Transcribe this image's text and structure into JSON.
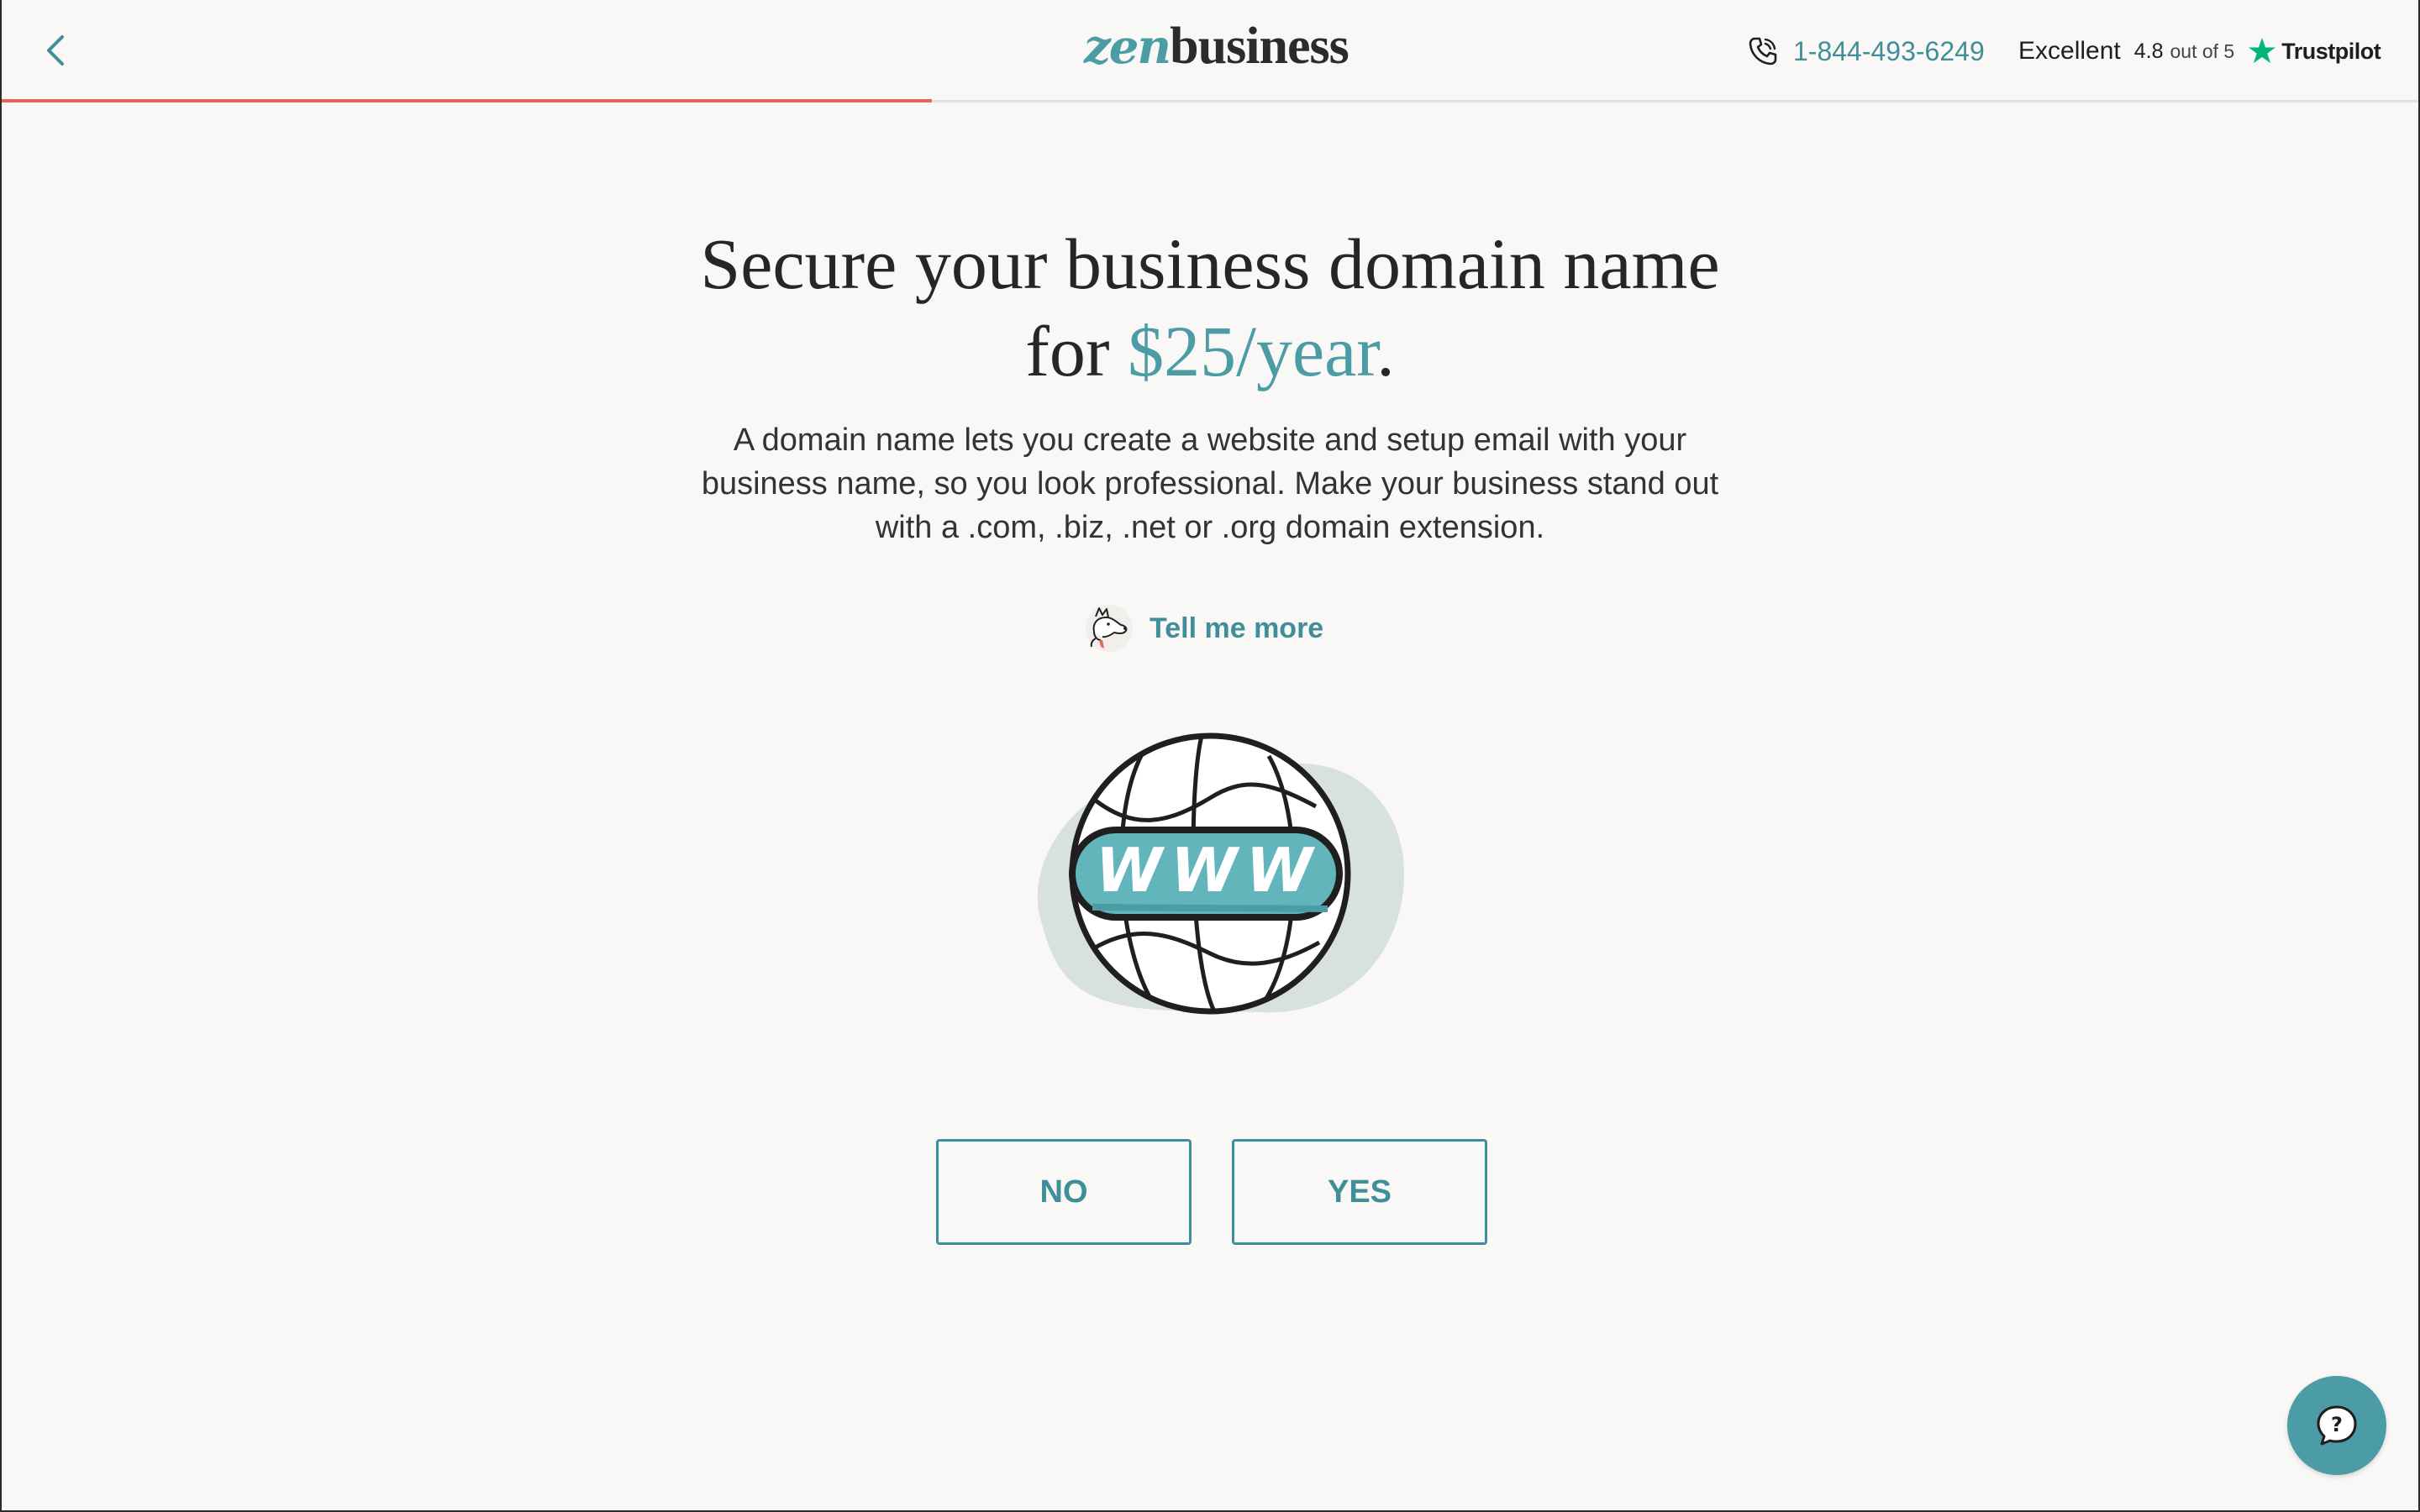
{
  "header": {
    "back_icon": "chevron-left-icon",
    "logo": {
      "zen": "zen",
      "business": "business"
    },
    "phone": {
      "icon": "phone-icon",
      "number": "1-844-493-6249"
    },
    "trustpilot": {
      "label": "Excellent",
      "rating": "4.8",
      "out_of": "out of 5",
      "brand": "Trustpilot",
      "star_color": "#00b67a"
    },
    "progress": 0.385
  },
  "main": {
    "title_line1": "Secure your business domain name",
    "title_for": "for ",
    "title_price": "$25/year",
    "title_period": ".",
    "description": "A domain name lets you create a website and setup email with your business name, so you look professional. Make your business stand out with a .com, .biz, .net or .org domain extension.",
    "tell_more": {
      "icon": "dog-mascot-icon",
      "label": "Tell me more"
    },
    "illustration": {
      "icon": "globe-www-icon",
      "text": "WWW"
    },
    "buttons": {
      "no": "NO",
      "yes": "YES"
    }
  },
  "chat": {
    "icon": "chat-help-icon",
    "glyph": "?"
  },
  "colors": {
    "accent": "#4b9ca5",
    "progress": "#e2675a",
    "background": "#f9f8f6"
  }
}
